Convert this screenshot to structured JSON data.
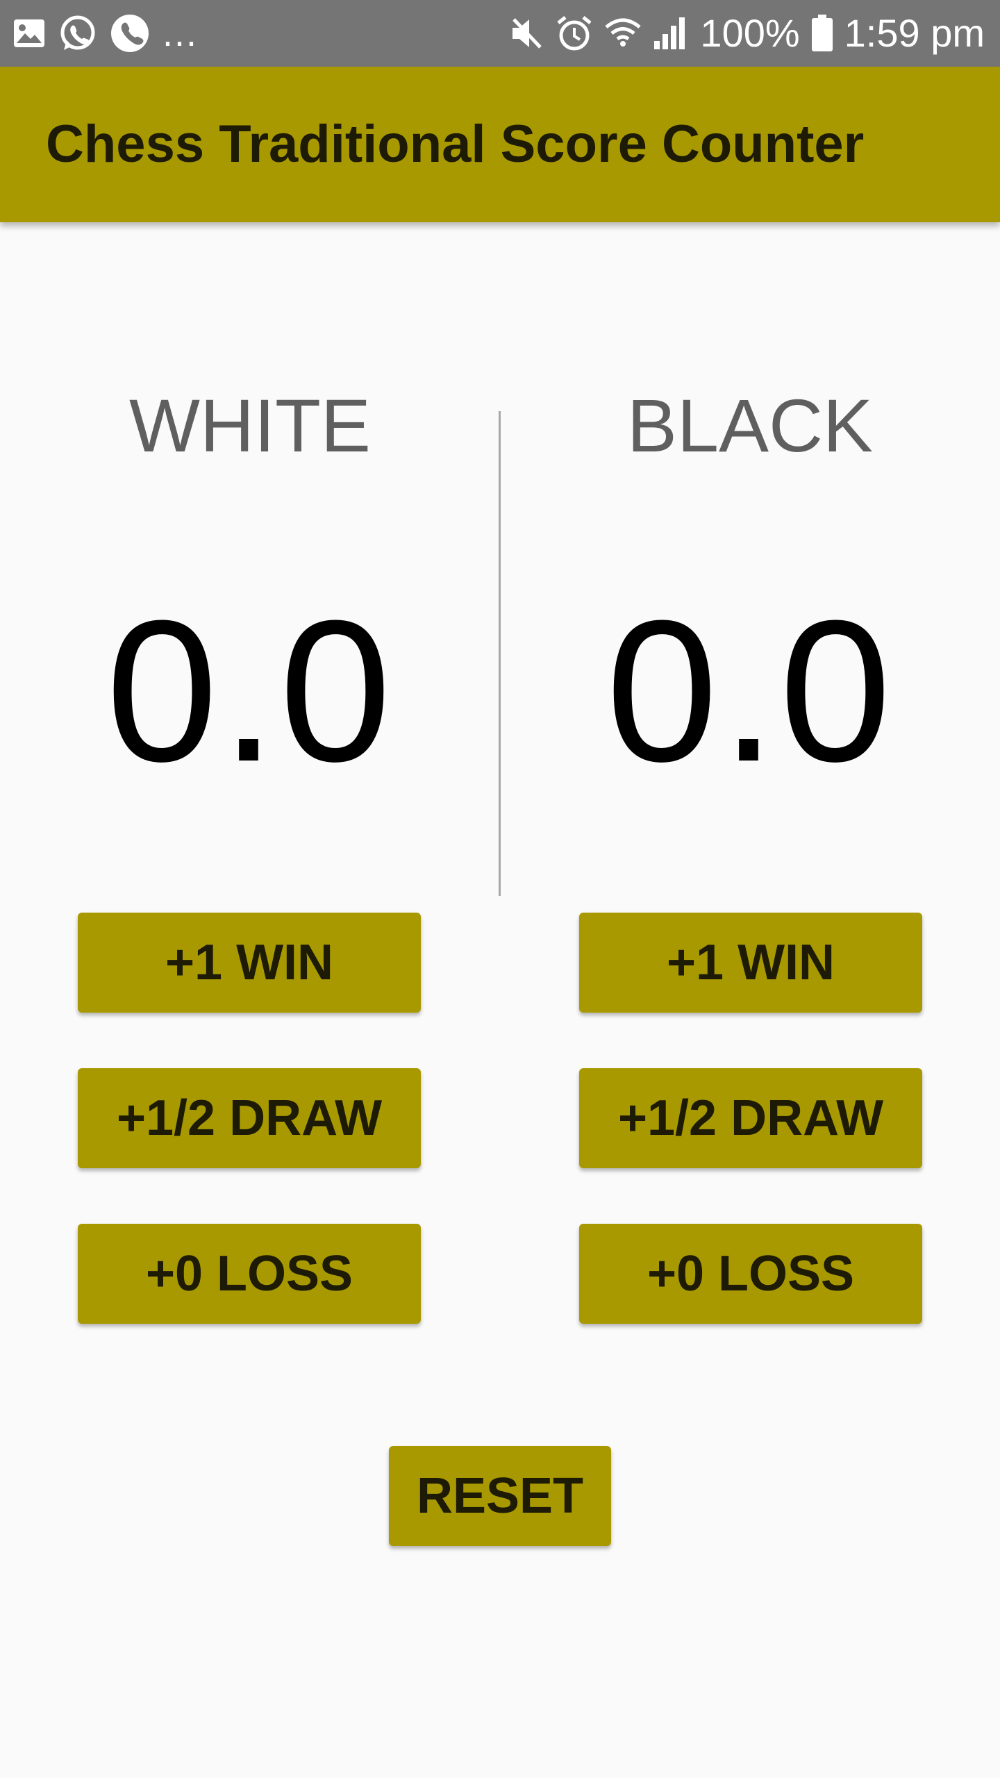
{
  "status_bar": {
    "left_icons": [
      "gallery-icon",
      "whatsapp-icon",
      "phone-call-icon"
    ],
    "overflow_dots": "...",
    "right_icons": [
      "mute-icon",
      "alarm-icon",
      "wifi-icon",
      "signal-icon",
      "battery-icon"
    ],
    "battery": "100%",
    "time": "1:59 pm",
    "background_color": "#757575"
  },
  "app_bar": {
    "title": "Chess Traditional Score Counter",
    "color": "#a89900"
  },
  "white": {
    "label": "WHITE",
    "score": "0.0",
    "win_button": "+1 WIN",
    "draw_button": "+1/2 DRAW",
    "loss_button": "+0 LOSS"
  },
  "black": {
    "label": "BLACK",
    "score": "0.0",
    "win_button": "+1 WIN",
    "draw_button": "+1/2 DRAW",
    "loss_button": "+0 LOSS"
  },
  "reset_button": "RESET",
  "colors": {
    "accent": "#a89900",
    "button_text": "#1d1a05",
    "label_text": "#5f5f5f",
    "score_text": "#000000",
    "background": "#fafafa"
  }
}
